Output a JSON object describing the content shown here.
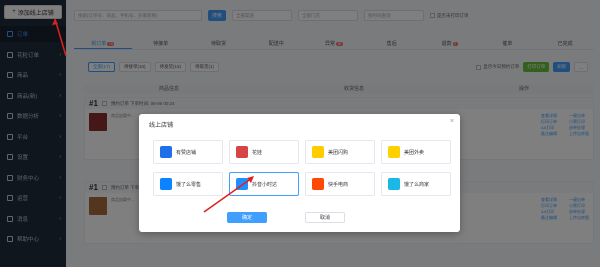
{
  "sidebar": {
    "add_store_label": "添加线上店铺",
    "items": [
      {
        "label": "订单",
        "active": true
      },
      {
        "label": "花粒订单"
      },
      {
        "label": "商品"
      },
      {
        "label": "商品(新)"
      },
      {
        "label": "数据分析"
      },
      {
        "label": "平台"
      },
      {
        "label": "设置"
      },
      {
        "label": "财务中心"
      },
      {
        "label": "运营"
      },
      {
        "label": "消息"
      },
      {
        "label": "帮助中心"
      }
    ]
  },
  "filters": {
    "search_placeholder": "搜索(订单号、商品、手机号、买家昵称)",
    "search_button": "搜索",
    "select1": "全部渠道",
    "select2": "全部门店",
    "select3": "按时间查询",
    "checkbox_label": "是否未打印订单"
  },
  "tabs": [
    {
      "label": "新订单",
      "badge": "10",
      "active": true
    },
    {
      "label": "待接单"
    },
    {
      "label": "待取货"
    },
    {
      "label": "配送中"
    },
    {
      "label": "异常",
      "badge": "86"
    },
    {
      "label": "售后"
    },
    {
      "label": "退款",
      "badge": "2"
    },
    {
      "label": "催单"
    },
    {
      "label": "已完成"
    }
  ],
  "subtabs": [
    {
      "label": "全部(17)",
      "active": true
    },
    {
      "label": "待接单(10)"
    },
    {
      "label": "待发货(15)"
    },
    {
      "label": "待取货(1)"
    }
  ],
  "tools": {
    "checkbox_label": "显示今日预约订单",
    "green_button": "打印订单",
    "blue_button": "刷新",
    "white_button": "..."
  },
  "table_head": [
    "商品信息",
    "收货信息",
    "操作"
  ],
  "orders": [
    {
      "num": "#1",
      "meta": "预约订单 下单时间: 06-06 00:24",
      "note": "商品加载中...",
      "actions": [
        "查看详情",
        "一键出单",
        "打印订单",
        "小票打印",
        "AA打印",
        "退单处理",
        "备注编辑",
        "上传出库图"
      ]
    },
    {
      "num": "#1",
      "meta": "预约订单 下单时间: 06-06 00:24",
      "note": "商品加载中...",
      "actions": [
        "查看详情",
        "一键出单",
        "打印订单",
        "小票打印",
        "AA打印",
        "退单处理",
        "备注编辑",
        "上传出库图"
      ]
    }
  ],
  "dialog": {
    "title": "线上店铺",
    "platforms": [
      {
        "label": "有赞店铺",
        "color": "#1f6feb",
        "icon": "youzan-icon"
      },
      {
        "label": "花娃",
        "color": "#d64545",
        "icon": "huawa-icon"
      },
      {
        "label": "美团闪购",
        "color": "#ffcc00",
        "icon": "meituan-shangou-icon"
      },
      {
        "label": "美团外卖",
        "color": "#ffd000",
        "icon": "meituan-waimai-icon"
      },
      {
        "label": "饿了么零售",
        "color": "#0b82ff",
        "icon": "eleme-retail-icon"
      },
      {
        "label": "抖音小时达",
        "color": "#1f8fff",
        "icon": "douyin-icon",
        "selected": true
      },
      {
        "label": "快手电商",
        "color": "#ff4906",
        "icon": "kuaishou-icon"
      },
      {
        "label": "饿了么商家",
        "color": "#19b8e6",
        "icon": "eleme-merchant-icon"
      }
    ],
    "ok_label": "确定",
    "cancel_label": "取消"
  }
}
